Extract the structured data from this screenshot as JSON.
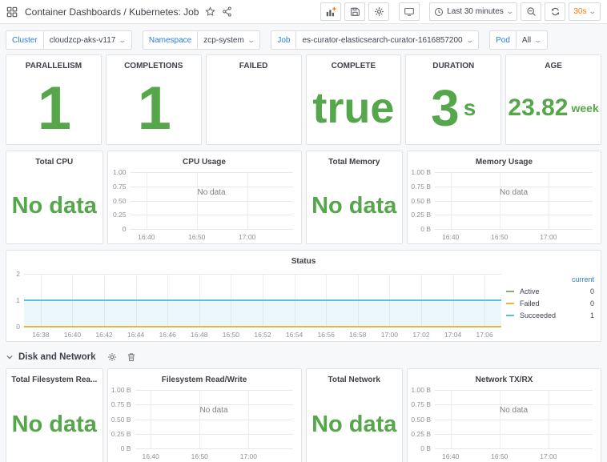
{
  "colors": {
    "green": "#56a64b",
    "blue": "#2b7ce0",
    "orange": "#ff780a",
    "series_green": "#7eb26d",
    "series_yellow": "#eab839",
    "series_blue": "#5bc0de",
    "series_blue_fill": "rgba(91,192,222,0.12)"
  },
  "navbar": {
    "title": "Container Dashboards / Kubernetes: Job",
    "time_range": "Last 30 minutes",
    "refresh_interval": "30s"
  },
  "variables": [
    {
      "label": "Cluster",
      "value": "cloudzcp-aks-v117"
    },
    {
      "label": "Namespace",
      "value": "zcp-system"
    },
    {
      "label": "Job",
      "value": "es-curator-elasticsearch-curator-1616857200"
    },
    {
      "label": "Pod",
      "value": "All"
    }
  ],
  "stats": [
    {
      "title": "PARALLELISM",
      "value": "1"
    },
    {
      "title": "COMPLETIONS",
      "value": "1"
    },
    {
      "title": "FAILED",
      "value": ""
    },
    {
      "title": "COMPLETE",
      "value": "true"
    },
    {
      "title": "DURATION",
      "value": "3",
      "suffix": "s"
    },
    {
      "title": "AGE",
      "value": "23.82",
      "suffix": "week"
    }
  ],
  "panels": {
    "total_cpu": {
      "title": "Total CPU",
      "value": "No data"
    },
    "total_memory": {
      "title": "Total Memory",
      "value": "No data"
    },
    "total_filesystem": {
      "title": "Total Filesystem Rea...",
      "value": "No data"
    },
    "total_network": {
      "title": "Total Network",
      "value": "No data"
    }
  },
  "row_header": {
    "label": "Disk and Network"
  },
  "chart_data": [
    {
      "key": "cpu_usage",
      "type": "line",
      "title": "CPU Usage",
      "no_data_text": "No data",
      "ylim": [
        0,
        1
      ],
      "y_ticks": [
        "1.00",
        "0.75",
        "0.50",
        "0.25",
        "0"
      ],
      "x_ticks": [
        "16:40",
        "16:50",
        "17:00"
      ],
      "series": []
    },
    {
      "key": "memory_usage",
      "type": "line",
      "title": "Memory Usage",
      "no_data_text": "No data",
      "ylim": [
        0,
        1
      ],
      "y_ticks": [
        "1.00 B",
        "0.75 B",
        "0.50 B",
        "0.25 B",
        "0 B"
      ],
      "x_ticks": [
        "16:40",
        "16:50",
        "17:00"
      ],
      "series": []
    },
    {
      "key": "status",
      "type": "area",
      "title": "Status",
      "ylim": [
        0,
        2
      ],
      "y_ticks": [
        "2",
        "1",
        "0"
      ],
      "x_ticks": [
        "16:38",
        "16:40",
        "16:42",
        "16:44",
        "16:46",
        "16:48",
        "16:50",
        "16:52",
        "16:54",
        "16:56",
        "16:58",
        "17:00",
        "17:02",
        "17:04",
        "17:06"
      ],
      "series": [
        {
          "name": "Active",
          "color": "series_green",
          "constant_value": 0,
          "current": 0
        },
        {
          "name": "Failed",
          "color": "series_yellow",
          "constant_value": 0,
          "current": 0
        },
        {
          "name": "Succeeded",
          "color": "series_blue",
          "constant_value": 1,
          "current": 1,
          "fill": true
        }
      ],
      "legend": {
        "header": "current"
      }
    },
    {
      "key": "filesystem_rw",
      "type": "line",
      "title": "Filesystem Read/Write",
      "no_data_text": "No data",
      "ylim": [
        0,
        1
      ],
      "y_ticks": [
        "1.00 B",
        "0.75 B",
        "0.50 B",
        "0.25 B",
        "0 B"
      ],
      "x_ticks": [
        "16:40",
        "16:50",
        "17:00"
      ],
      "series": []
    },
    {
      "key": "network_txrx",
      "type": "line",
      "title": "Network TX/RX",
      "no_data_text": "No data",
      "ylim": [
        0,
        1
      ],
      "y_ticks": [
        "1.00 B",
        "0.75 B",
        "0.50 B",
        "0.25 B",
        "0 B"
      ],
      "x_ticks": [
        "16:40",
        "16:50",
        "17:00"
      ],
      "series": []
    }
  ]
}
